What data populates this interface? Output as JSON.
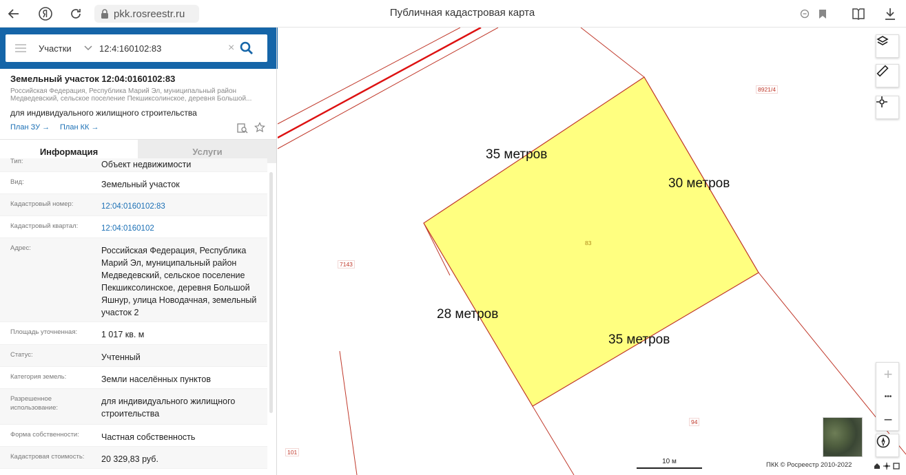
{
  "browser": {
    "url": "pkk.rosreestr.ru",
    "page_title": "Публичная кадастровая карта",
    "icons": [
      "back-icon",
      "yandex-icon",
      "reload-icon",
      "lock-icon",
      "zoom-icon",
      "bookmark-icon",
      "reader-icon",
      "download-icon"
    ]
  },
  "search": {
    "type": "Участки",
    "query": "12:4:160102:83",
    "clear": "×"
  },
  "card": {
    "title": "Земельный участок 12:04:0160102:83",
    "address_short": "Российская Федерация, Республика Марий Эл, муниципальный район Медведевский, сельское поселение Пекшиксолинское, деревня Большой...",
    "purpose": "для индивидуального жилищного строительства",
    "link_plan_zu": "План ЗУ →",
    "link_plan_kk": "План КК →"
  },
  "tabs": {
    "info": "Информация",
    "services": "Услуги"
  },
  "info_rows": [
    {
      "key": "Тип:",
      "value": "Объект недвижимости"
    },
    {
      "key": "Вид:",
      "value": "Земельный участок"
    },
    {
      "key": "Кадастровый номер:",
      "value": "12:04:0160102:83"
    },
    {
      "key": "Кадастровый квартал:",
      "value": "12:04:0160102"
    },
    {
      "key": "Адрес:",
      "value": "Российская Федерация, Республика Марий Эл, муниципальный район Медведевский, сельское поселение Пекшиксолинское, деревня Большой Яшнур, улица Новодачная, земельный участок 2"
    },
    {
      "key": "Площадь уточненная:",
      "value": "1 017 кв. м"
    },
    {
      "key": "Статус:",
      "value": "Учтенный"
    },
    {
      "key": "Категория земель:",
      "value": "Земли населённых пунктов"
    },
    {
      "key": "Разрешенное использование:",
      "value": "для индивидуального жилищного строительства"
    },
    {
      "key": "Форма собственности:",
      "value": "Частная собственность"
    },
    {
      "key": "Кадастровая стоимость:",
      "value": "20 329,83 руб."
    }
  ],
  "map": {
    "parcel_labels": {
      "p8921": "8921/4",
      "p7143": "7143",
      "p83": "83",
      "p94": "94",
      "p101": "101"
    },
    "measurements": {
      "top": "35 метров",
      "right": "30 метров",
      "left": "28 метров",
      "bottom": "35 метров"
    },
    "scale": "10 м",
    "copyright": "ПКК © Росреестр 2010-2022",
    "zoom_in": "+",
    "zoom_more": "•••",
    "zoom_out": "−",
    "colors": {
      "parcel_fill": "#ffff80",
      "boundary": "#c0392b",
      "accent": "#1565a8"
    }
  }
}
